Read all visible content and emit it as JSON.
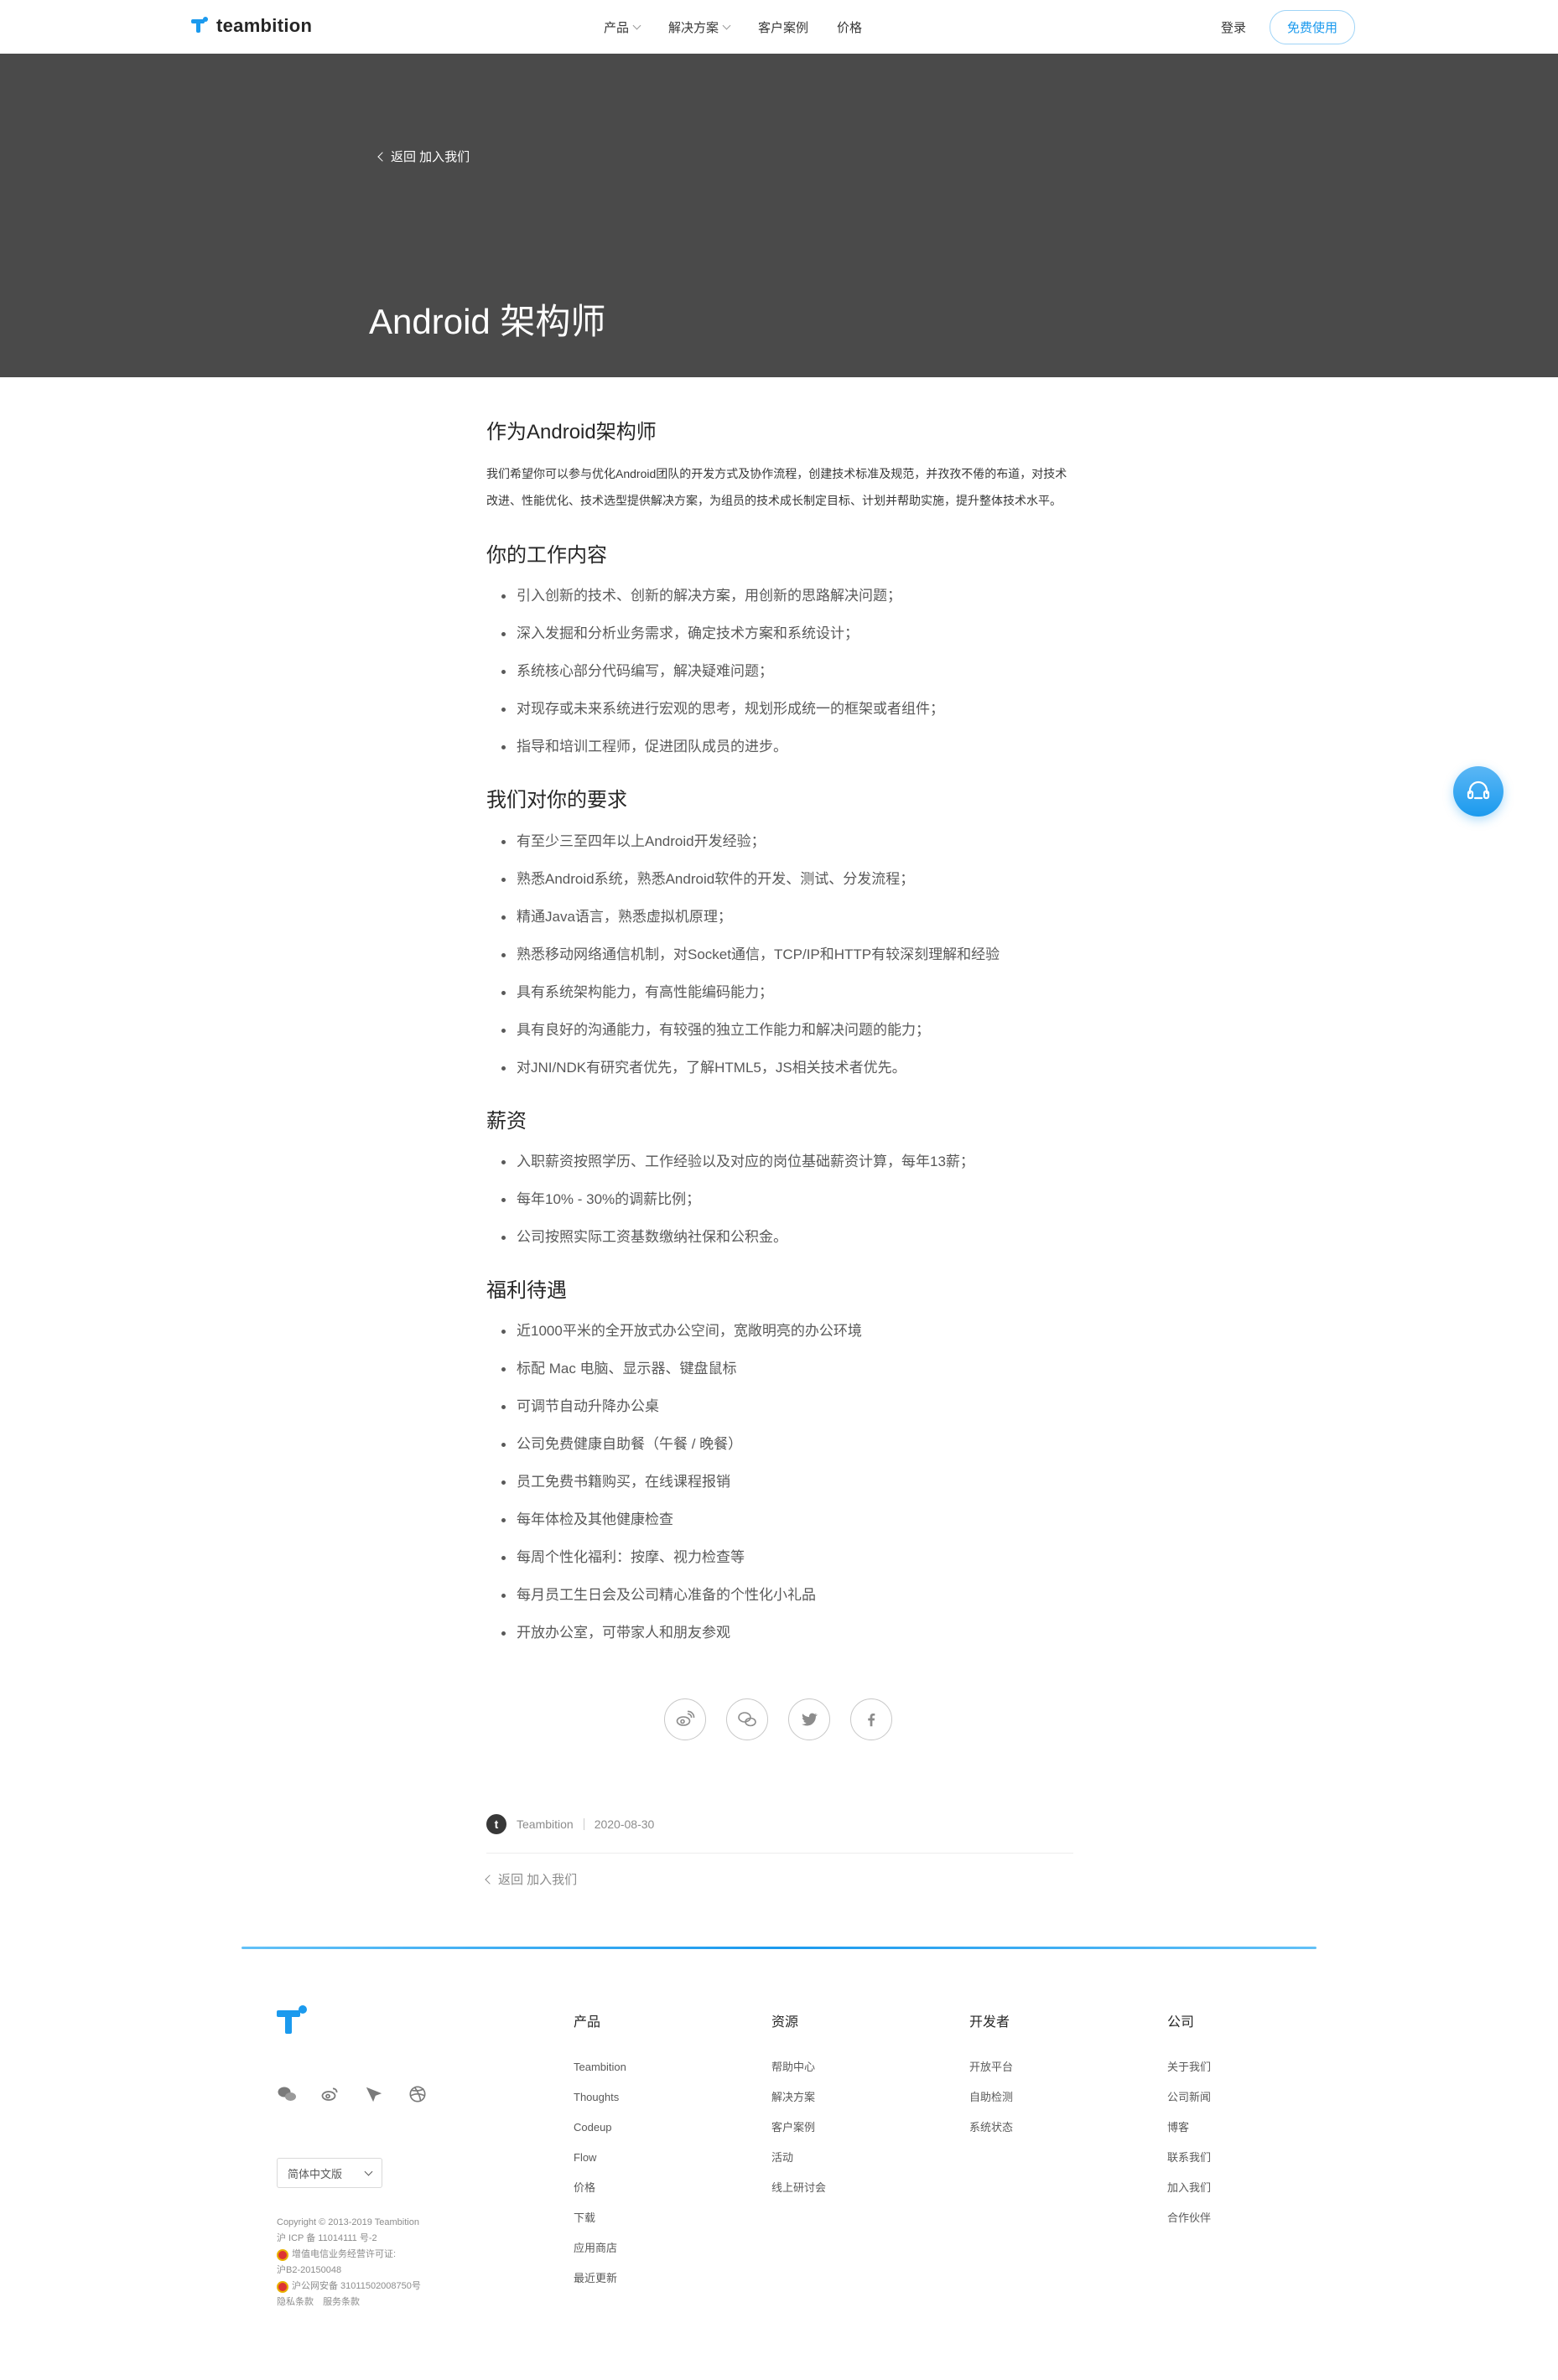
{
  "nav": {
    "brand": "teambition",
    "items": [
      {
        "label": "产品",
        "dropdown": true
      },
      {
        "label": "解决方案",
        "dropdown": true
      },
      {
        "label": "客户案例",
        "dropdown": false
      },
      {
        "label": "价格",
        "dropdown": false
      }
    ],
    "login": "登录",
    "free_trial": "免费使用"
  },
  "hero": {
    "back_label": "返回 加入我们",
    "title": "Android 架构师",
    "background": "#4a4a4a"
  },
  "article": {
    "intro_heading": "作为Android架构师",
    "intro_text": "我们希望你可以参与优化Android团队的开发方式及协作流程，创建技术标准及规范，并孜孜不倦的布道，对技术改进、性能优化、技术选型提供解决方案，为组员的技术成长制定目标、计划并帮助实施，提升整体技术水平。",
    "sections": [
      {
        "heading": "你的工作内容",
        "items": [
          "引入创新的技术、创新的解决方案，用创新的思路解决问题；",
          "深入发掘和分析业务需求，确定技术方案和系统设计；",
          "系统核心部分代码编写，解决疑难问题；",
          "对现存或未来系统进行宏观的思考，规划形成统一的框架或者组件；",
          "指导和培训工程师，促进团队成员的进步。"
        ]
      },
      {
        "heading": "我们对你的要求",
        "items": [
          "有至少三至四年以上Android开发经验；",
          "熟悉Android系统，熟悉Android软件的开发、测试、分发流程；",
          "精通Java语言，熟悉虚拟机原理；",
          "熟悉移动网络通信机制，对Socket通信，TCP/IP和HTTP有较深刻理解和经验",
          "具有系统架构能力，有高性能编码能力；",
          "具有良好的沟通能力，有较强的独立工作能力和解决问题的能力；",
          "对JNI/NDK有研究者优先，了解HTML5，JS相关技术者优先。"
        ]
      },
      {
        "heading": "薪资",
        "items": [
          "入职薪资按照学历、工作经验以及对应的岗位基础薪资计算，每年13薪；",
          "每年10% - 30%的调薪比例；",
          "公司按照实际工资基数缴纳社保和公积金。"
        ]
      },
      {
        "heading": "福利待遇",
        "items": [
          "近1000平米的全开放式办公空间，宽敞明亮的办公环境",
          "标配 Mac 电脑、显示器、键盘鼠标",
          "可调节自动升降办公桌",
          "公司免费健康自助餐（午餐 / 晚餐）",
          "员工免费书籍购买，在线课程报销",
          "每年体检及其他健康检查",
          "每周个性化福利：按摩、视力检查等",
          "每月员工生日会及公司精心准备的个性化小礼品",
          "开放办公室，可带家人和朋友参观"
        ]
      }
    ],
    "share_icons": [
      "weibo-icon",
      "wechat-icon",
      "twitter-icon",
      "facebook-icon"
    ],
    "author": "Teambition",
    "author_initial": "t",
    "date": "2020-08-30",
    "back_label": "返回 加入我们"
  },
  "footer": {
    "social_icons": [
      "wechat-icon",
      "weibo-icon",
      "paper-plane-icon",
      "dribbble-icon"
    ],
    "language": "简体中文版",
    "copyright": "Copyright © 2013-2019 Teambition",
    "icp": "沪 ICP 备 11014111 号-2",
    "license_label": "增值电信业务经营许可证:",
    "license_no": "沪B2-20150048",
    "police_record": "沪公网安备 31011502008750号",
    "privacy": "隐私条款",
    "terms": "服务条款",
    "columns": [
      {
        "heading": "产品",
        "items": [
          "Teambition",
          "Thoughts",
          "Codeup",
          "Flow",
          "价格",
          "下载",
          "应用商店",
          "最近更新"
        ]
      },
      {
        "heading": "资源",
        "items": [
          "帮助中心",
          "解决方案",
          "客户案例",
          "活动",
          "线上研讨会"
        ]
      },
      {
        "heading": "开发者",
        "items": [
          "开放平台",
          "自助检测",
          "系统状态"
        ]
      },
      {
        "heading": "公司",
        "items": [
          "关于我们",
          "公司新闻",
          "博客",
          "联系我们",
          "加入我们",
          "合作伙伴"
        ]
      }
    ]
  },
  "colors": {
    "accent": "#1b9aee",
    "hero_bg": "#4a4a4a"
  }
}
